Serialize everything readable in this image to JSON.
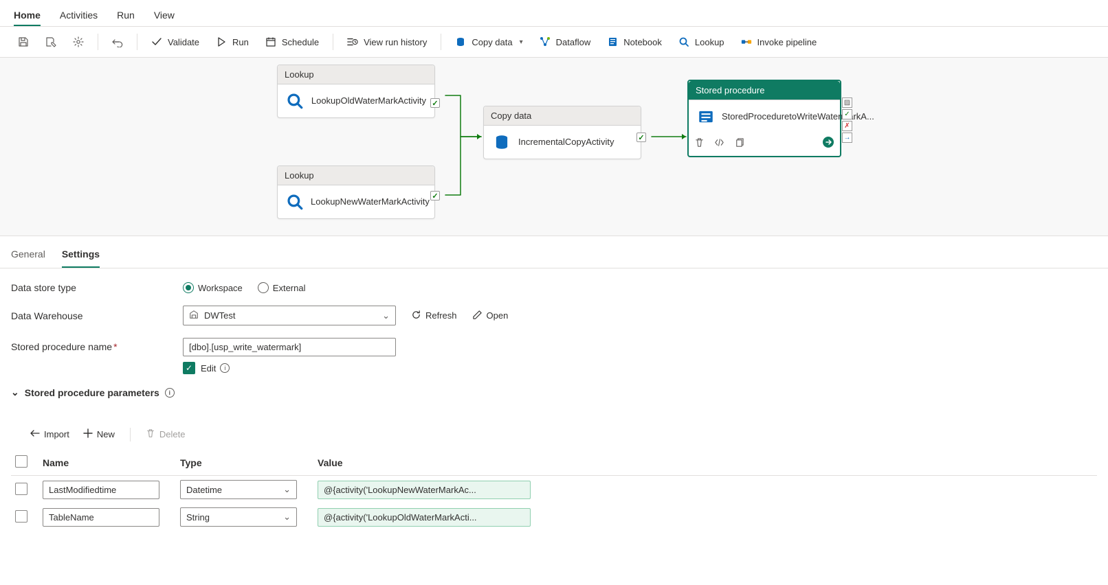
{
  "topTabs": {
    "home": "Home",
    "activities": "Activities",
    "run": "Run",
    "view": "View"
  },
  "toolbar": {
    "validate": "Validate",
    "run": "Run",
    "schedule": "Schedule",
    "viewRunHistory": "View run history",
    "copyData": "Copy data",
    "dataflow": "Dataflow",
    "notebook": "Notebook",
    "lookup": "Lookup",
    "invokePipeline": "Invoke pipeline"
  },
  "activities": {
    "lookup1": {
      "type": "Lookup",
      "name": "LookupOldWaterMarkActivity"
    },
    "lookup2": {
      "type": "Lookup",
      "name": "LookupNewWaterMarkActivity"
    },
    "copy": {
      "type": "Copy data",
      "name": "IncrementalCopyActivity"
    },
    "sproc": {
      "type": "Stored procedure",
      "name": "StoredProceduretoWriteWatermarkA..."
    }
  },
  "panelTabs": {
    "general": "General",
    "settings": "Settings"
  },
  "settings": {
    "dataStoreType": {
      "label": "Data store type",
      "workspace": "Workspace",
      "external": "External"
    },
    "dataWarehouse": {
      "label": "Data Warehouse",
      "value": "DWTest",
      "refresh": "Refresh",
      "open": "Open"
    },
    "sprocName": {
      "label": "Stored procedure name",
      "value": "[dbo].[usp_write_watermark]",
      "editLabel": "Edit"
    },
    "paramsSection": "Stored procedure parameters",
    "paramBar": {
      "import": "Import",
      "new": "New",
      "delete": "Delete"
    },
    "columns": {
      "name": "Name",
      "type": "Type",
      "value": "Value"
    },
    "rows": [
      {
        "name": "LastModifiedtime",
        "type": "Datetime",
        "value": "@{activity('LookupNewWaterMarkAc..."
      },
      {
        "name": "TableName",
        "type": "String",
        "value": "@{activity('LookupOldWaterMarkActi..."
      }
    ]
  }
}
